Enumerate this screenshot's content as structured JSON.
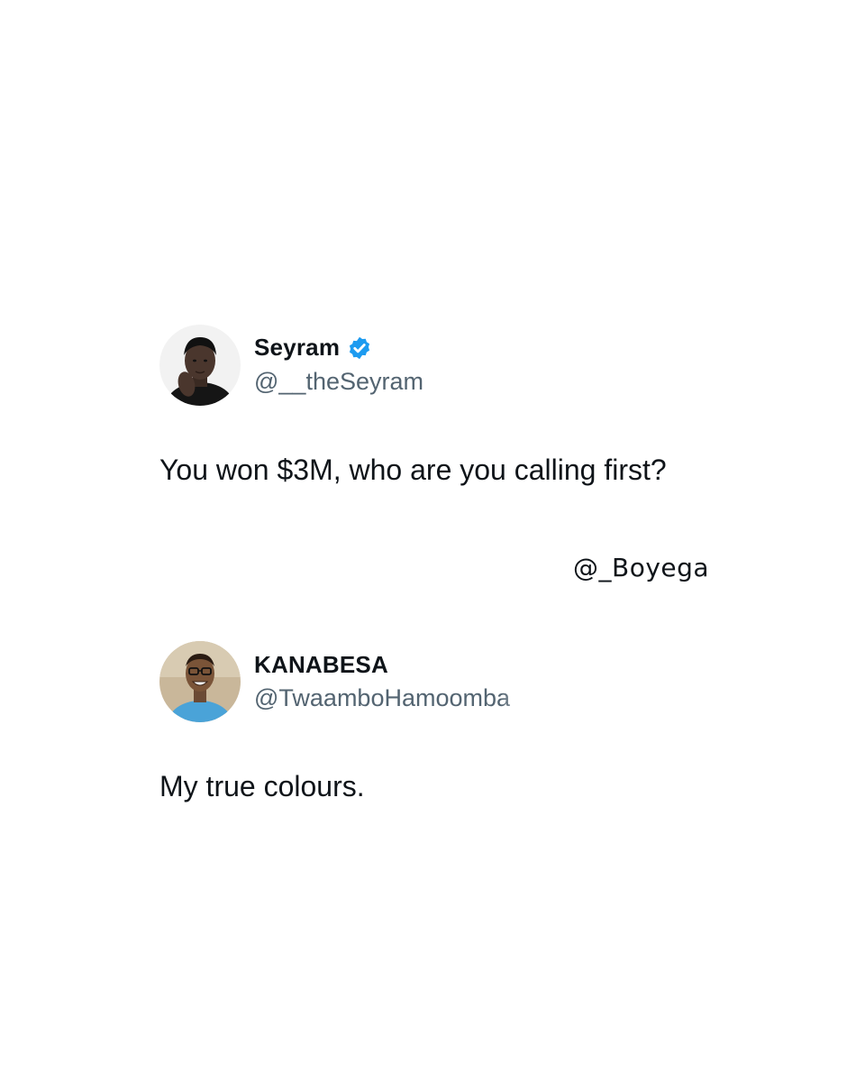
{
  "tweets": [
    {
      "display_name": "Seyram",
      "verified": true,
      "handle": "@__theSeyram",
      "text": "You won $3M, who are you calling first?"
    },
    {
      "display_name": "KANABESA",
      "verified": false,
      "handle": "@TwaamboHamoomba",
      "text": "My true colours."
    }
  ],
  "credit": "@_Boyega",
  "colors": {
    "verified_badge": "#1d9bf0",
    "handle": "#536471",
    "text": "#0f1419"
  }
}
